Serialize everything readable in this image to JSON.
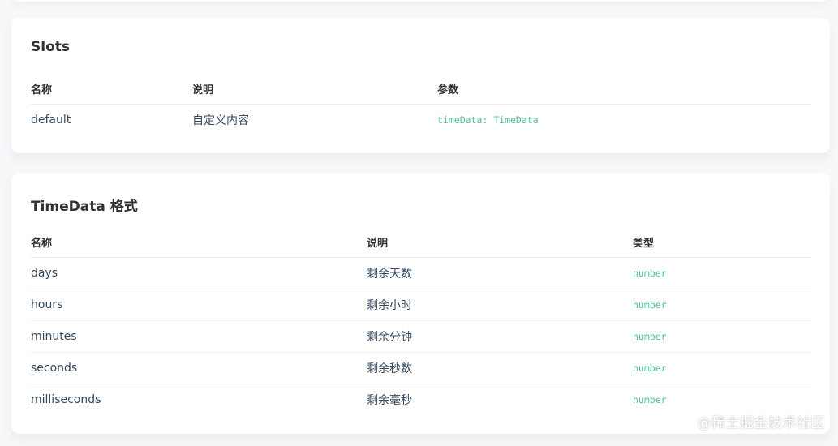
{
  "slots": {
    "title": "Slots",
    "headers": [
      "名称",
      "说明",
      "参数"
    ],
    "rows": [
      {
        "name": "default",
        "desc": "自定义内容",
        "param": "timeData: TimeData"
      }
    ]
  },
  "timedata": {
    "title": "TimeData 格式",
    "headers": [
      "名称",
      "说明",
      "类型"
    ],
    "rows": [
      {
        "name": "days",
        "desc": "剩余天数",
        "type": "number"
      },
      {
        "name": "hours",
        "desc": "剩余小时",
        "type": "number"
      },
      {
        "name": "minutes",
        "desc": "剩余分钟",
        "type": "number"
      },
      {
        "name": "seconds",
        "desc": "剩余秒数",
        "type": "number"
      },
      {
        "name": "milliseconds",
        "desc": "剩余毫秒",
        "type": "number"
      }
    ]
  },
  "watermark": "@稀土掘金技术社区",
  "colors": {
    "code": "#4fc08d",
    "text": "#34495e",
    "heading": "#323233"
  }
}
